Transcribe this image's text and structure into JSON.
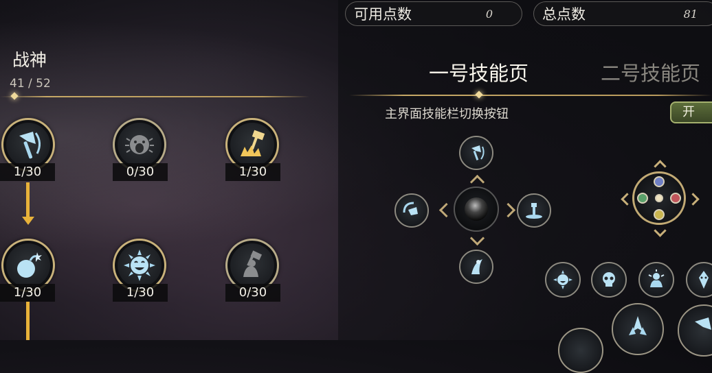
{
  "header": {
    "available_points_label": "可用点数",
    "available_points_value": "0",
    "total_points_label": "总点数",
    "total_points_value": "81"
  },
  "god": {
    "name": "战神",
    "progress": "41 / 52"
  },
  "skill_nodes": [
    {
      "label": "1/30",
      "icon": "axe-icon",
      "state": "unlocked"
    },
    {
      "label": "0/30",
      "icon": "roaring-face-icon",
      "state": "locked"
    },
    {
      "label": "1/30",
      "icon": "hammer-strike-icon",
      "state": "unlocked"
    },
    {
      "label": "1/30",
      "icon": "bomb-icon",
      "state": "unlocked"
    },
    {
      "label": "1/30",
      "icon": "sun-face-icon",
      "state": "unlocked"
    },
    {
      "label": "0/30",
      "icon": "hammer-figure-icon",
      "state": "locked"
    }
  ],
  "tabs": [
    {
      "label": "一号技能页",
      "active": true
    },
    {
      "label": "二号技能页",
      "active": false
    }
  ],
  "toggle": {
    "label": "主界面技能栏切换按钮",
    "value": "开"
  },
  "colors": {
    "accent_gold": "#c9b27a",
    "arrow_orange": "#e8b23a",
    "skill_icon_blue": "#a9d8ef",
    "toggle_green": "#5c6d3a",
    "gem_blue": "#6f7fc4",
    "gem_red": "#c0555b",
    "gem_green": "#5aa06a",
    "gem_yellow": "#c9b54f"
  }
}
